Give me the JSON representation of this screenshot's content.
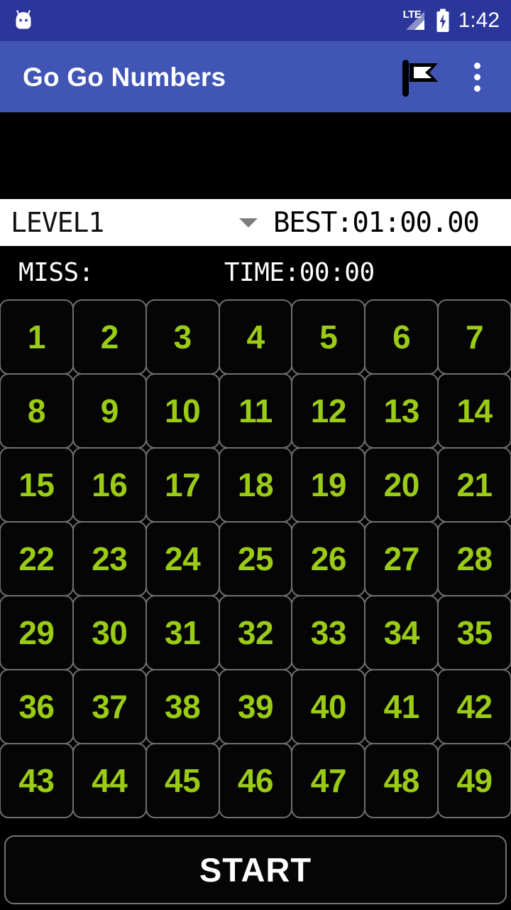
{
  "status_bar": {
    "app_icon": "android-head-icon",
    "network_label": "LTE",
    "signal_icon": "signal-bars-icon",
    "battery_icon": "battery-charging-icon",
    "time": "1:42",
    "background_color": "#2B369B"
  },
  "app_bar": {
    "title": "Go Go Numbers",
    "flag_icon": "flag-icon",
    "overflow_icon": "overflow-menu-icon",
    "background_color": "#4055B4",
    "text_color": "#FFFFFF"
  },
  "banner": {
    "background_color": "#000000"
  },
  "info_bar": {
    "level_value": "LEVEL1",
    "level_options": [
      "LEVEL1"
    ],
    "caret_icon": "chevron-down-icon",
    "best_text": "BEST:01:00.00",
    "background_color": "#FFFFFF"
  },
  "stats": {
    "miss_text": "MISS:",
    "time_text": "TIME:00:00"
  },
  "grid": {
    "columns": 7,
    "rows": 7,
    "number_color": "#9ACB15",
    "cell_background": "#050505",
    "cell_border_color": "#6E6E6E",
    "numbers": [
      "1",
      "2",
      "3",
      "4",
      "5",
      "6",
      "7",
      "8",
      "9",
      "10",
      "11",
      "12",
      "13",
      "14",
      "15",
      "16",
      "17",
      "18",
      "19",
      "20",
      "21",
      "22",
      "23",
      "24",
      "25",
      "26",
      "27",
      "28",
      "29",
      "30",
      "31",
      "32",
      "33",
      "34",
      "35",
      "36",
      "37",
      "38",
      "39",
      "40",
      "41",
      "42",
      "43",
      "44",
      "45",
      "46",
      "47",
      "48",
      "49"
    ]
  },
  "start_button": {
    "label": "START",
    "text_color": "#FFFFFF",
    "border_color": "#747474"
  }
}
